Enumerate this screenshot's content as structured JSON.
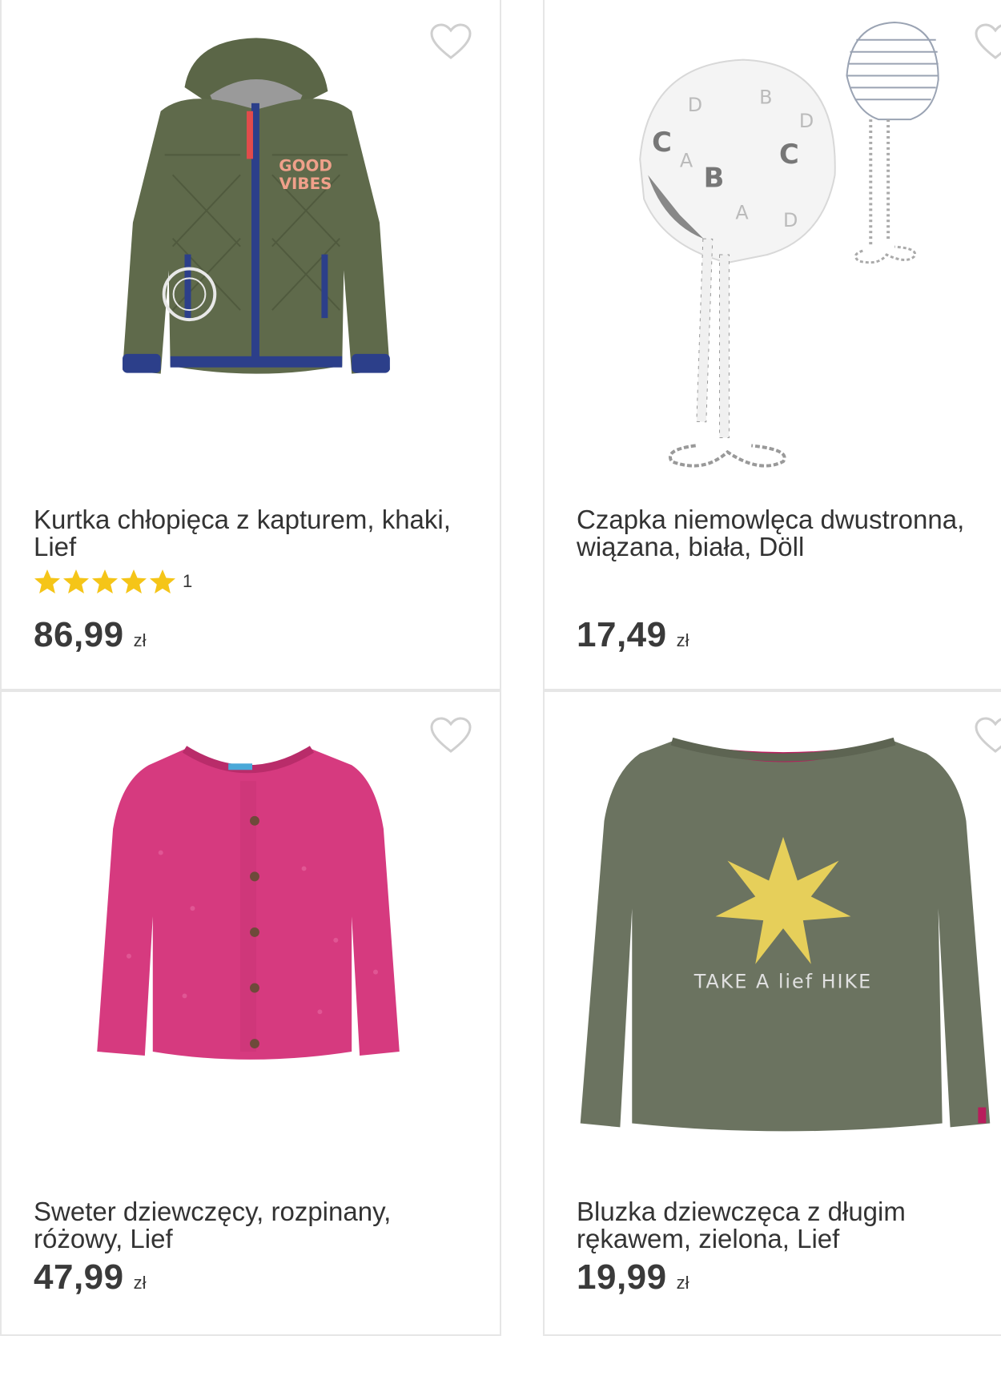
{
  "products": [
    {
      "title": "Kurtka chłopięca z kapturem, khaki, Lief",
      "rating_count": "1",
      "stars": 5,
      "price": "86,99",
      "currency": "zł",
      "image": "jacket-image",
      "print_text_1": "GOOD",
      "print_text_2": "VIBES"
    },
    {
      "title": "Czapka niemowlęca dwustronna, wiązana, biała, Döll",
      "price": "17,49",
      "currency": "zł",
      "image": "hat-image"
    },
    {
      "title": "Sweter dziewczęcy, rozpinany, różowy, Lief",
      "price": "47,99",
      "currency": "zł",
      "image": "cardigan-image"
    },
    {
      "title": "Bluzka dziewczęca z długim rękawem, zielona, Lief",
      "price": "19,99",
      "currency": "zł",
      "image": "longsleeve-image",
      "print_text": "TAKE A lief HIKE"
    }
  ],
  "icons": {
    "favorite": "heart-outline-icon",
    "rating": "star-icon"
  },
  "colors": {
    "star": "#f5c518",
    "heart_outline": "#cfcfcf",
    "jacket": "#5f6a4b",
    "zipper": "#2c3f8a",
    "cardigan": "#d63a7f",
    "tee": "#6b7360",
    "tee_star": "#e6cf5a"
  }
}
